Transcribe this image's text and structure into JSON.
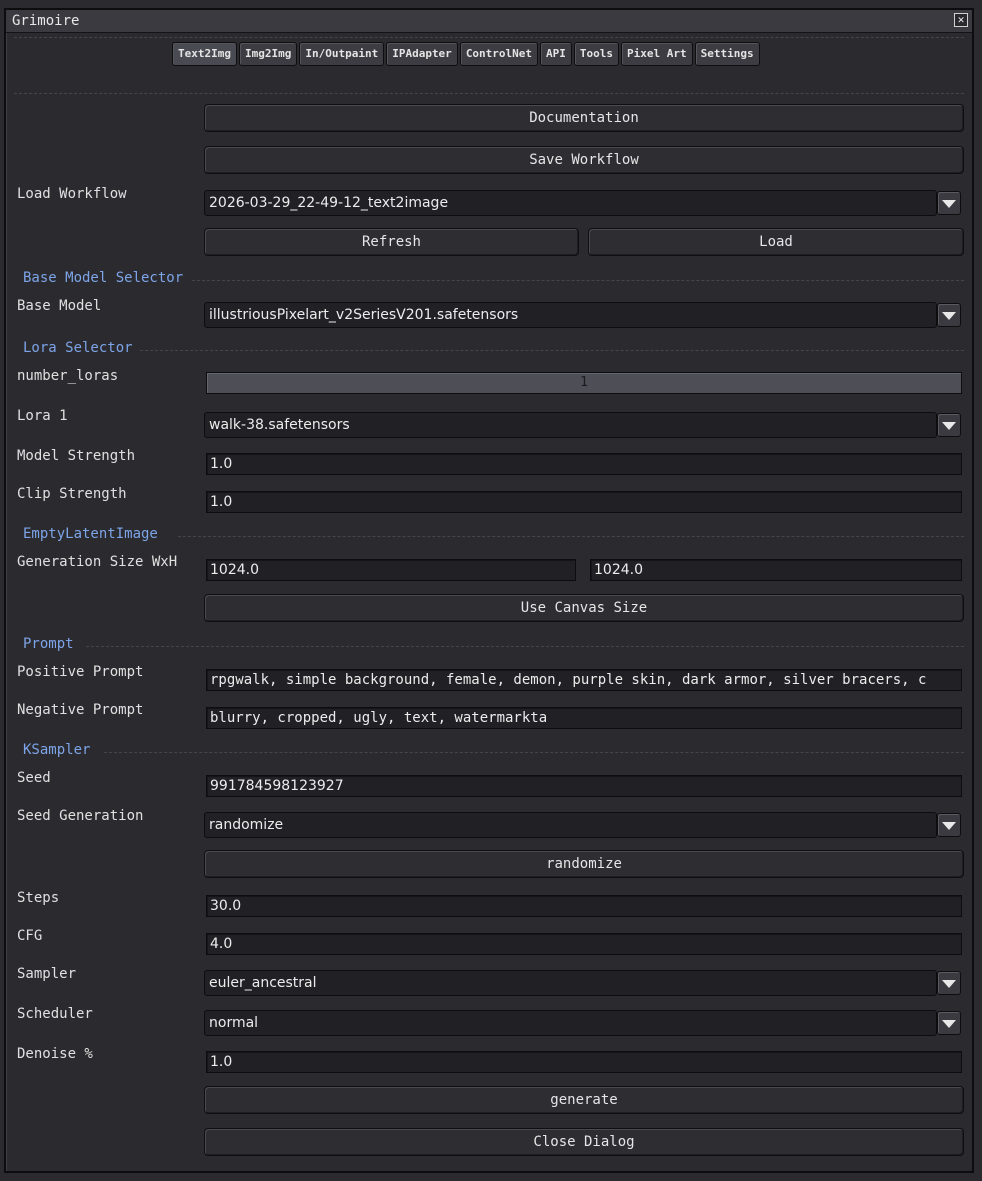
{
  "window": {
    "title": "Grimoire"
  },
  "tabs": [
    "Text2Img",
    "Img2Img",
    "In/Outpaint",
    "IPAdapter",
    "ControlNet",
    "API",
    "Tools",
    "Pixel Art",
    "Settings"
  ],
  "workflow": {
    "documentation_label": "Documentation",
    "save_label": "Save Workflow",
    "load_workflow_label": "Load Workflow",
    "selected_workflow": "2026-03-29_22-49-12_text2image",
    "refresh_label": "Refresh",
    "load_label": "Load"
  },
  "base_model": {
    "section_title": "Base Model Selector",
    "label": "Base Model",
    "value": "illustriousPixelart_v2SeriesV201.safetensors"
  },
  "lora": {
    "section_title": "Lora Selector",
    "number_label": "number_loras",
    "number_value": "1",
    "lora1_label": "Lora 1",
    "lora1_value": "walk-38.safetensors",
    "model_strength_label": "Model Strength",
    "model_strength_value": "1.0",
    "clip_strength_label": "Clip Strength",
    "clip_strength_value": "1.0"
  },
  "latent": {
    "section_title": "EmptyLatentImage",
    "size_label": "Generation Size WxH",
    "width": "1024.0",
    "height": "1024.0",
    "canvas_size_label": "Use Canvas Size"
  },
  "prompt": {
    "section_title": "Prompt",
    "positive_label": "Positive Prompt",
    "positive_value": "rpgwalk, simple background, female, demon, purple skin, dark armor, silver bracers, c",
    "negative_label": "Negative Prompt",
    "negative_value": "blurry, cropped, ugly, text, watermarkta"
  },
  "ksampler": {
    "section_title": "KSampler",
    "seed_label": "Seed",
    "seed_value": "991784598123927",
    "seed_gen_label": "Seed Generation",
    "seed_gen_value": "randomize",
    "randomize_button": "randomize",
    "steps_label": "Steps",
    "steps_value": "30.0",
    "cfg_label": "CFG",
    "cfg_value": "4.0",
    "sampler_label": "Sampler",
    "sampler_value": "euler_ancestral",
    "scheduler_label": "Scheduler",
    "scheduler_value": "normal",
    "denoise_label": "Denoise %",
    "denoise_value": "1.0"
  },
  "actions": {
    "generate_label": "generate",
    "close_label": "Close Dialog"
  },
  "colors": {
    "background": "#2b2b2f",
    "section_title": "#7da4e8",
    "field_bg": "#212125"
  }
}
